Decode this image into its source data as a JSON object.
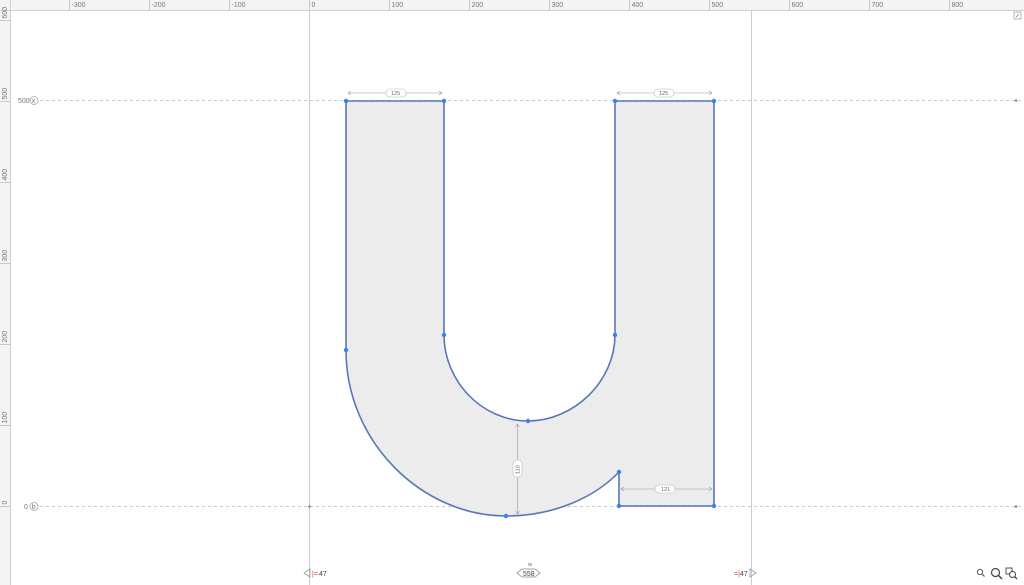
{
  "rulers": {
    "top": [
      {
        "label": "-300",
        "value": -300
      },
      {
        "label": "-200",
        "value": -200
      },
      {
        "label": "-100",
        "value": -100
      },
      {
        "label": "0",
        "value": 0
      },
      {
        "label": "100",
        "value": 100
      },
      {
        "label": "200",
        "value": 200
      },
      {
        "label": "300",
        "value": 300
      },
      {
        "label": "400",
        "value": 400
      },
      {
        "label": "500",
        "value": 500
      },
      {
        "label": "600",
        "value": 600
      },
      {
        "label": "700",
        "value": 700
      },
      {
        "label": "800",
        "value": 800
      }
    ],
    "left": [
      {
        "label": "600",
        "value": 600
      },
      {
        "label": "500",
        "value": 500
      },
      {
        "label": "400",
        "value": 400
      },
      {
        "label": "300",
        "value": 300
      },
      {
        "label": "200",
        "value": 200
      },
      {
        "label": "100",
        "value": 100
      },
      {
        "label": "0",
        "value": 0
      }
    ]
  },
  "guidelines": {
    "x_height": {
      "label": "500",
      "marker": "x"
    },
    "baseline": {
      "label": "0",
      "marker": "b"
    }
  },
  "dimensions": {
    "left_stem_width": "125",
    "right_stem_width": "125",
    "bowl_thickness": "110",
    "spur_width": "121"
  },
  "metrics": {
    "lsb": "47",
    "width_label": "w",
    "width": "558",
    "rsb": "47"
  },
  "colors": {
    "outline": "#5b77b8",
    "node": "#3c7ff2",
    "glyph_fill": "#ececec",
    "ruler_bg": "#f4f4f4",
    "guide": "#b8b8b8",
    "lsb_marker": "#d43a2a"
  },
  "icons": {
    "corner": "corner-toggle-icon",
    "zoom_out": "zoom-out-icon",
    "zoom_in": "zoom-in-icon",
    "zoom_fit": "zoom-fit-icon"
  }
}
